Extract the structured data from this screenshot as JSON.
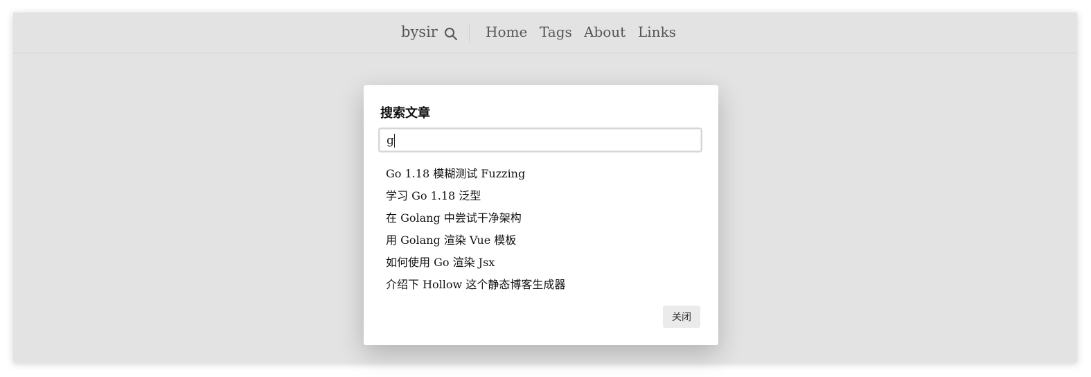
{
  "nav": {
    "brand": "bysir",
    "search_icon": "search-icon",
    "links": [
      "Home",
      "Tags",
      "About",
      "Links"
    ]
  },
  "modal": {
    "title": "搜索文章",
    "search_value": "g",
    "results": [
      "Go 1.18 模糊测试 Fuzzing",
      "学习 Go 1.18 泛型",
      "在 Golang 中尝试干净架构",
      "用 Golang 渲染 Vue 模板",
      "如何使用 Go 渲染 Jsx",
      "介绍下 Hollow 这个静态博客生成器"
    ],
    "close_label": "关闭"
  },
  "colors": {
    "backdrop": "#e3e3e3",
    "nav_text": "#555555",
    "modal_bg": "#ffffff",
    "button_bg": "#ebebeb"
  }
}
